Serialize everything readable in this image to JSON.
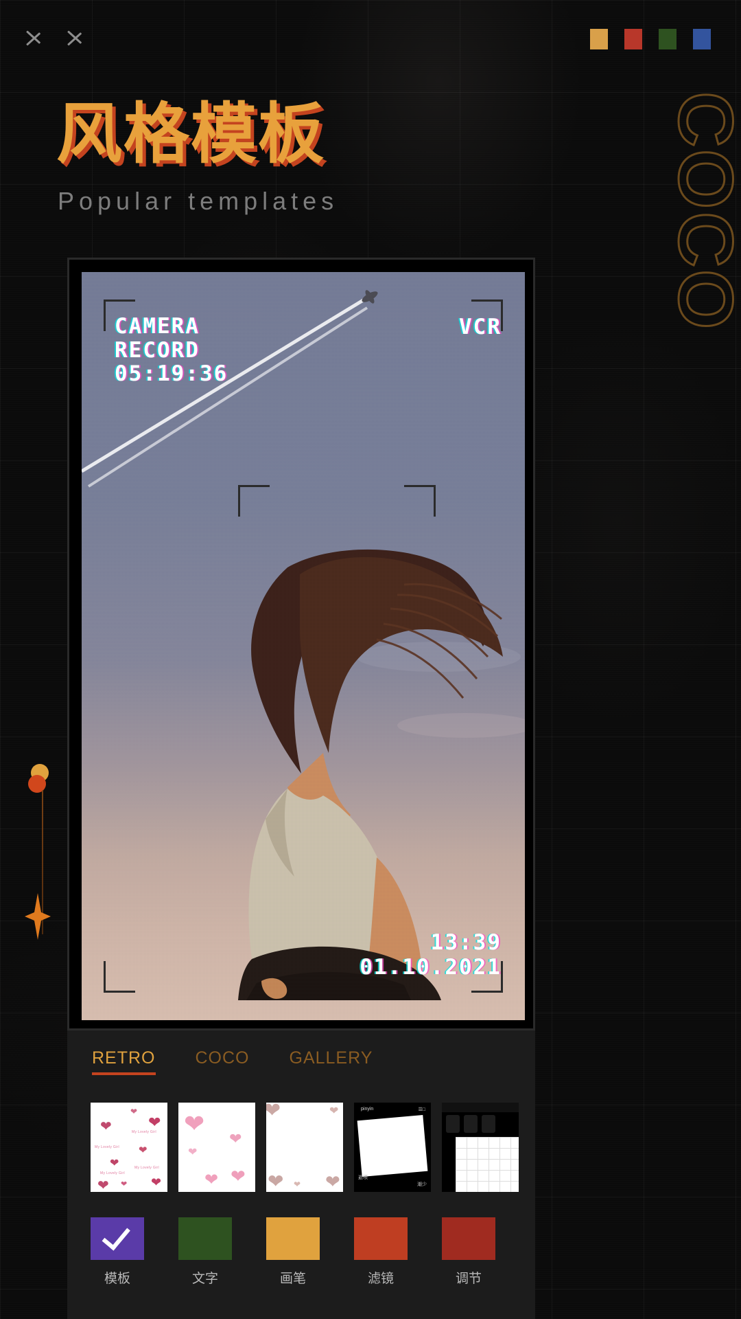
{
  "background": {
    "base_color": "#0b0b0b",
    "grid": true
  },
  "header": {
    "nav_icons": [
      {
        "name": "chevron-right-icon-1"
      },
      {
        "name": "chevron-right-icon-2"
      }
    ],
    "swatches": [
      {
        "name": "swatch-amber",
        "color": "#D9A04A"
      },
      {
        "name": "swatch-red",
        "color": "#B8372A"
      },
      {
        "name": "swatch-green",
        "color": "#2E5220"
      },
      {
        "name": "swatch-blue",
        "color": "#33549E"
      }
    ]
  },
  "hero": {
    "title": "风格模板",
    "title_color": "#E8A13C",
    "title_shadow_color": "#C4431F",
    "subtitle": "Popular templates",
    "subtitle_color": "#7d7d7d",
    "side_word": "COCO",
    "side_word_color": "#6b4a1c"
  },
  "rail": {
    "dot_amber_color": "#E0A23E",
    "dot_orange_color": "#D1471C",
    "sparkle_color": "#E07A1E",
    "sparkle_name": "four-point-sparkle-icon"
  },
  "preview": {
    "overlay": {
      "camera_label": "CAMERA",
      "record_label": "RECORD",
      "timecode": "05:19:36",
      "format_label": "VCR",
      "clock": "13:39",
      "date": "01.10.2021"
    }
  },
  "panel": {
    "tabs": [
      {
        "label": "RETRO",
        "active": true
      },
      {
        "label": "COCO",
        "active": false
      },
      {
        "label": "GALLERY",
        "active": false
      }
    ],
    "thumbnails": [
      {
        "name": "template-hearts-small",
        "caption": "My Lovely Girl"
      },
      {
        "name": "template-hearts-large",
        "caption": ""
      },
      {
        "name": "template-pearl-hearts",
        "caption": ""
      },
      {
        "name": "template-phone-screen",
        "caption": "pinyin"
      },
      {
        "name": "template-grid-screen",
        "caption": ""
      }
    ],
    "toolbar": [
      {
        "label": "模板",
        "color": "#5A3BA8",
        "selected": true,
        "icon": "check-icon"
      },
      {
        "label": "文字",
        "color": "#2E5220",
        "selected": false,
        "icon": ""
      },
      {
        "label": "画笔",
        "color": "#E0A23E",
        "selected": false,
        "icon": ""
      },
      {
        "label": "滤镜",
        "color": "#BF3E22",
        "selected": false,
        "icon": ""
      },
      {
        "label": "调节",
        "color": "#A02B20",
        "selected": false,
        "icon": ""
      }
    ]
  }
}
